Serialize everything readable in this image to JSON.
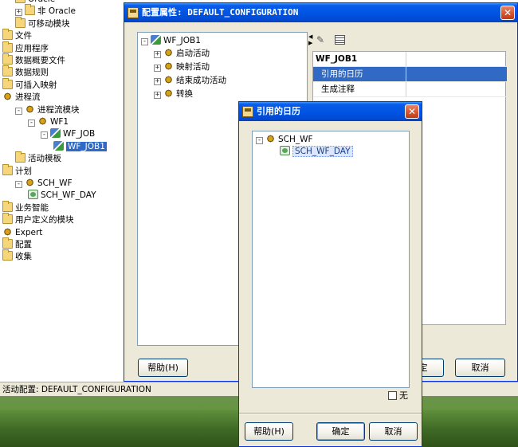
{
  "left_tree": [
    {
      "label": "Oracle",
      "indent": 1,
      "icon": "folder-icon",
      "expander": ""
    },
    {
      "label": "非 Oracle",
      "indent": 1,
      "icon": "folder-icon",
      "expander": "+"
    },
    {
      "label": "可移动模块",
      "indent": 1,
      "icon": "folder-icon",
      "expander": ""
    },
    {
      "label": "文件",
      "indent": 0,
      "icon": "folder-icon",
      "expander": ""
    },
    {
      "label": "应用程序",
      "indent": 0,
      "icon": "folder-icon",
      "expander": ""
    },
    {
      "label": "数据概要文件",
      "indent": 0,
      "icon": "folder-icon",
      "expander": ""
    },
    {
      "label": "数据规则",
      "indent": 0,
      "icon": "folder-icon",
      "expander": ""
    },
    {
      "label": "可插入映射",
      "indent": 0,
      "icon": "folder-icon",
      "expander": ""
    },
    {
      "label": "进程流",
      "indent": 0,
      "icon": "gear-icon",
      "expander": ""
    },
    {
      "label": "进程流模块",
      "indent": 1,
      "icon": "gear-icon",
      "expander": "-"
    },
    {
      "label": "WF1",
      "indent": 2,
      "icon": "gear-icon",
      "expander": "-"
    },
    {
      "label": "WF_JOB",
      "indent": 3,
      "icon": "flow-icon",
      "expander": "-"
    },
    {
      "label": "WF_JOB1",
      "indent": 4,
      "icon": "flow-icon",
      "expander": "",
      "selected": true
    },
    {
      "label": "活动模板",
      "indent": 1,
      "icon": "folder-icon",
      "expander": ""
    },
    {
      "label": "计划",
      "indent": 0,
      "icon": "folder-icon",
      "expander": ""
    },
    {
      "label": "SCH_WF",
      "indent": 1,
      "icon": "gear-icon",
      "expander": "-"
    },
    {
      "label": "SCH_WF_DAY",
      "indent": 2,
      "icon": "calendar-icon",
      "expander": ""
    },
    {
      "label": "业务智能",
      "indent": 0,
      "icon": "folder-icon",
      "expander": ""
    },
    {
      "label": "用户定义的模块",
      "indent": 0,
      "icon": "folder-icon",
      "expander": ""
    },
    {
      "label": "Expert",
      "indent": 0,
      "icon": "gear-icon",
      "expander": ""
    },
    {
      "label": "配置",
      "indent": 0,
      "icon": "folder-icon",
      "expander": ""
    },
    {
      "label": "收集",
      "indent": 0,
      "icon": "folder-icon",
      "expander": ""
    }
  ],
  "status_bar": "活动配置: DEFAULT_CONFIGURATION",
  "config_dialog": {
    "title": "配置属性: DEFAULT_CONFIGURATION",
    "tree_root": "WF_JOB1",
    "tree_children": [
      "启动活动",
      "映射活动",
      "结束成功活动",
      "转换"
    ],
    "props_header": "WF_JOB1",
    "props": [
      {
        "key": "引用的日历",
        "value": "",
        "selected": true
      },
      {
        "key": "生成注释",
        "value": ""
      }
    ],
    "help_button": "帮助(H)",
    "ok_button": "确定",
    "cancel_button": "取消"
  },
  "calendar_dialog": {
    "title": "引用的日历",
    "tree_root": "SCH_WF",
    "tree_child": "SCH_WF_DAY",
    "none_checkbox": "无",
    "help_button": "帮助(H)",
    "ok_button": "确定",
    "cancel_button": "取消"
  },
  "colors": {
    "titlebar": "#0055e5",
    "selection": "#316ac5",
    "dialog_bg": "#ece9d8"
  }
}
